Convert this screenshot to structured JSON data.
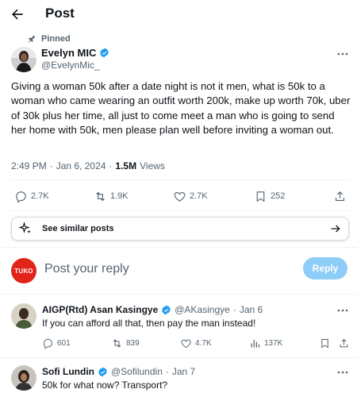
{
  "header": {
    "title": "Post"
  },
  "pinned_label": "Pinned",
  "post": {
    "author_name": "Evelyn MIC",
    "author_handle": "@EvelynMic_",
    "text": "Giving a woman 50k after a date night is not it men, what is 50k to a woman who came wearing an outfit worth 200k, make up worth 70k, uber of 30k plus her time, all just to come meet a man who is going to send her home with 50k, men please plan well before inviting a woman out.",
    "time": "2:49 PM",
    "date": "Jan 6, 2024",
    "views_count": "1.5M",
    "views_label": "Views",
    "stats": {
      "replies": "2.7K",
      "reposts": "1.9K",
      "likes": "2.7K",
      "bookmarks": "252"
    }
  },
  "similar_posts_label": "See similar posts",
  "reply_box": {
    "avatar_text": "TUKO",
    "placeholder": "Post your reply",
    "button_label": "Reply"
  },
  "comments": [
    {
      "name": "AIGP(Rtd) Asan Kasingye",
      "handle": "@AKasingye",
      "date": "Jan 6",
      "text": "If you can afford all that, then pay the man instead!",
      "replies": "601",
      "reposts": "839",
      "likes": "4.7K",
      "views": "137K"
    },
    {
      "name": "Sofi Lundin",
      "handle": "@Sofilundin",
      "date": "Jan 7",
      "text": "50k for what now? Transport?"
    }
  ],
  "colors": {
    "verified": "#1d9bf0",
    "reply_button": "#8ecdf8",
    "tuko_red": "#e2231a"
  }
}
